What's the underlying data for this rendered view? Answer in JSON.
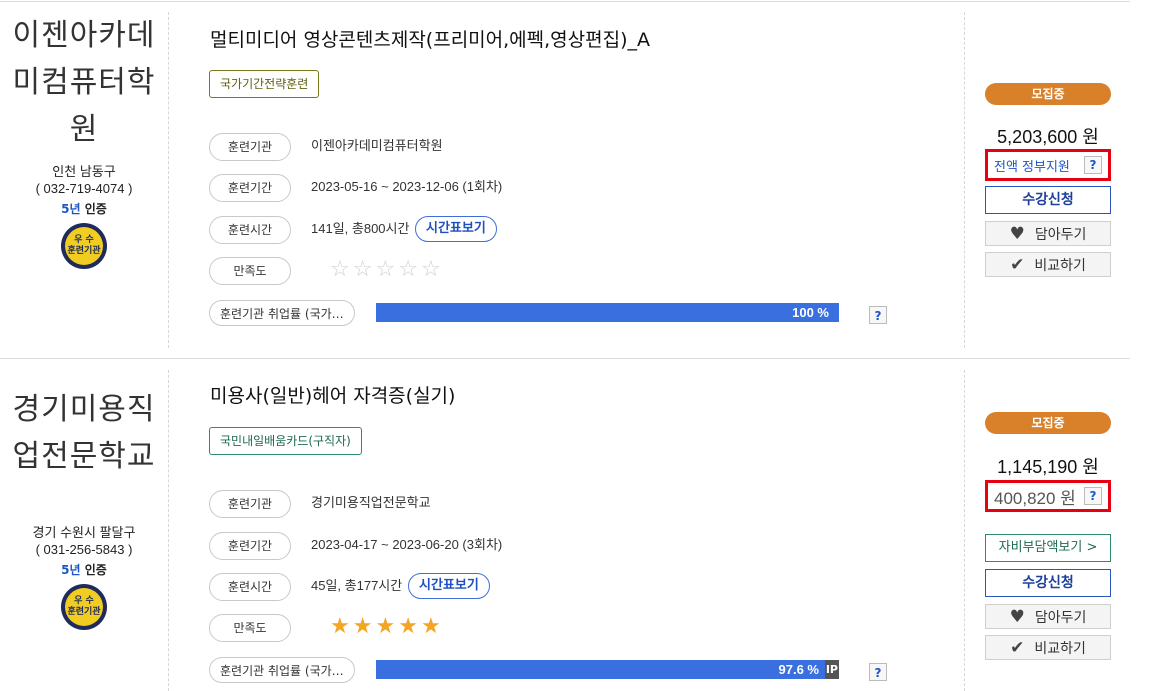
{
  "cards": [
    {
      "institution": {
        "name_line1": "이젠아카데",
        "name_line2": "미컴퓨터학",
        "name_line3": "원",
        "address": "인천 남동구",
        "phone": "( 032-719-4074 )",
        "cert_num": "5년",
        "cert_text": "인증",
        "badge_top": "우 수",
        "badge_bottom": "훈련기관"
      },
      "course": {
        "title": "멀티미디어 영상콘텐츠제작(프리미어,에펙,영상편집)_A",
        "tag": "국가기간전략훈련"
      },
      "rows": {
        "org_label": "훈련기관",
        "org_value": "이젠아카데미컴퓨터학원",
        "period_label": "훈련기간",
        "period_value": "2023-05-16 ~ 2023-12-06 (1회차)",
        "hours_label": "훈련시간",
        "hours_value": "141일, 총800시간",
        "timetable_btn": "시간표보기",
        "satisfaction_label": "만족도",
        "satisfaction_stars": 0,
        "employment_label": "훈련기관 취업률 (국가…",
        "employment_value": "100 %",
        "employment_rate": 100
      },
      "side": {
        "status": "모집중",
        "price": "5,203,600 원",
        "support_text": "전액 정부지원",
        "q": "?",
        "apply": "수강신청",
        "wish": "담아두기",
        "compare": "비교하기"
      }
    },
    {
      "institution": {
        "name_line1": "경기미용직",
        "name_line2": "업전문학교",
        "address": "경기 수원시 팔달구",
        "phone": "( 031-256-5843 )",
        "cert_num": "5년",
        "cert_text": "인증",
        "badge_top": "우 수",
        "badge_bottom": "훈련기관"
      },
      "course": {
        "title": "미용사(일반)헤어 자격증(실기)",
        "tag": "국민내일배움카드(구직자)"
      },
      "rows": {
        "org_label": "훈련기관",
        "org_value": "경기미용직업전문학교",
        "period_label": "훈련기간",
        "period_value": "2023-04-17 ~ 2023-06-20 (3회차)",
        "hours_label": "훈련시간",
        "hours_value": "45일, 총177시간",
        "timetable_btn": "시간표보기",
        "satisfaction_label": "만족도",
        "satisfaction_stars": 5,
        "employment_label": "훈련기관 취업률 (국가…",
        "employment_value": "97.6 %",
        "employment_rate": 97.6,
        "employment_tail": "IP"
      },
      "side": {
        "status": "모집중",
        "price": "1,145,190 원",
        "support_text": "400,820 원",
        "q": "?",
        "self_pay": "자비부담액보기 >",
        "apply": "수강신청",
        "wish": "담아두기",
        "compare": "비교하기"
      }
    }
  ]
}
